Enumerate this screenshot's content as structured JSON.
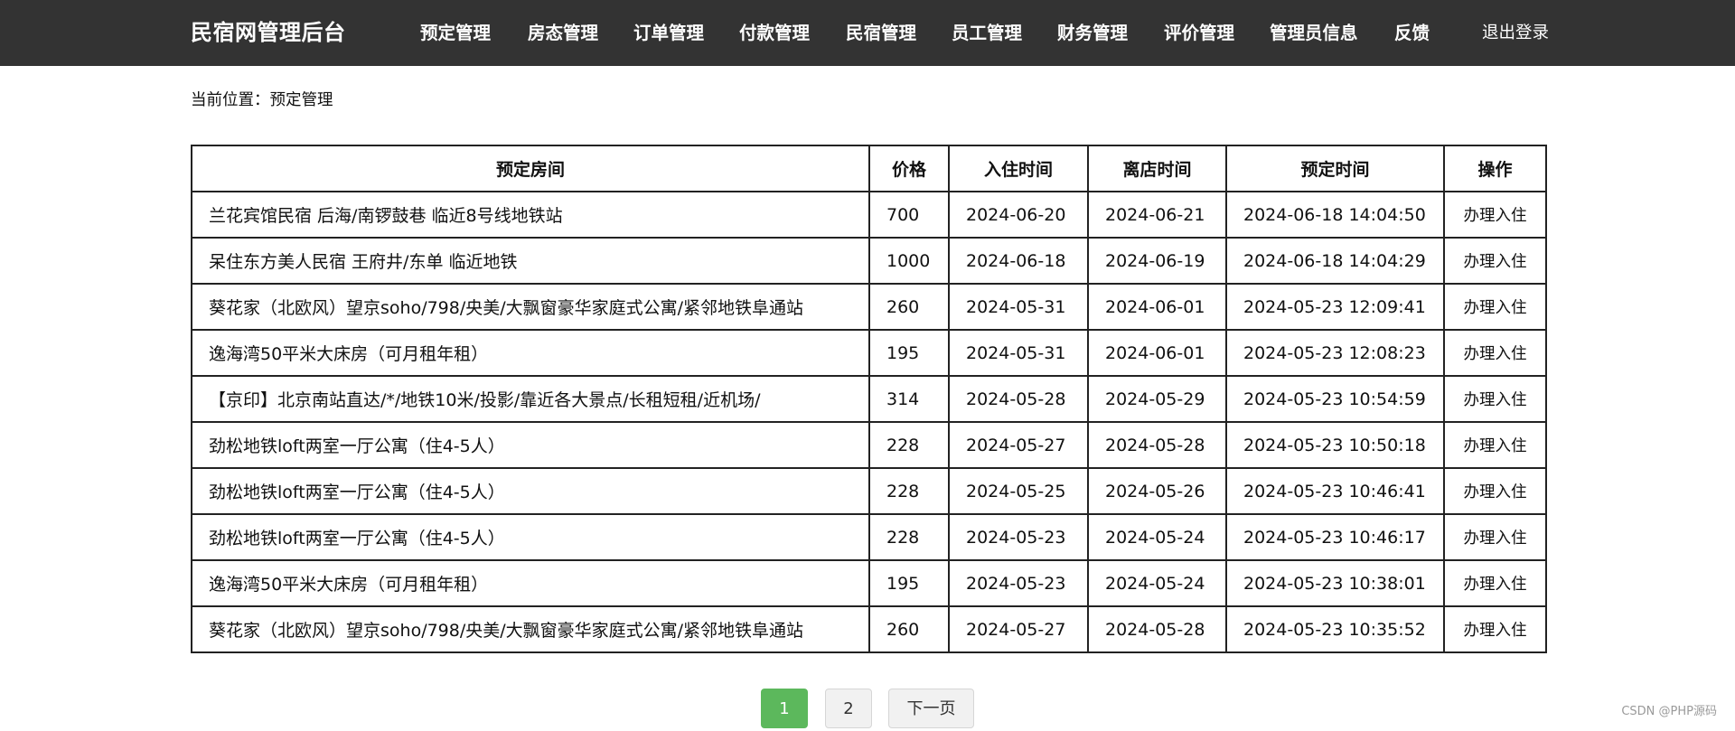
{
  "header": {
    "brand": "民宿网管理后台",
    "nav": [
      {
        "label": "预定管理"
      },
      {
        "label": "房态管理"
      },
      {
        "label": "订单管理"
      },
      {
        "label": "付款管理"
      },
      {
        "label": "民宿管理"
      },
      {
        "label": "员工管理"
      },
      {
        "label": "财务管理"
      },
      {
        "label": "评价管理"
      },
      {
        "label": "管理员信息"
      },
      {
        "label": "反馈"
      }
    ],
    "logout": "退出登录"
  },
  "breadcrumb": "当前位置：预定管理",
  "table": {
    "columns": [
      "预定房间",
      "价格",
      "入住时间",
      "离店时间",
      "预定时间",
      "操作"
    ],
    "rows": [
      [
        "兰花宾馆民宿 后海/南锣鼓巷 临近8号线地铁站",
        "700",
        "2024-06-20",
        "2024-06-21",
        "2024-06-18 14:04:50",
        "办理入住"
      ],
      [
        "呆住东方美人民宿 王府井/东单 临近地铁",
        "1000",
        "2024-06-18",
        "2024-06-19",
        "2024-06-18 14:04:29",
        "办理入住"
      ],
      [
        "葵花家（北欧风）望京soho/798/央美/大飘窗豪华家庭式公寓/紧邻地铁阜通站",
        "260",
        "2024-05-31",
        "2024-06-01",
        "2024-05-23 12:09:41",
        "办理入住"
      ],
      [
        "逸海湾50平米大床房（可月租年租）",
        "195",
        "2024-05-31",
        "2024-06-01",
        "2024-05-23 12:08:23",
        "办理入住"
      ],
      [
        "【京印】北京南站直达/*/地铁10米/投影/靠近各大景点/长租短租/近机场/",
        "314",
        "2024-05-28",
        "2024-05-29",
        "2024-05-23 10:54:59",
        "办理入住"
      ],
      [
        "劲松地铁loft两室一厅公寓（住4-5人）",
        "228",
        "2024-05-27",
        "2024-05-28",
        "2024-05-23 10:50:18",
        "办理入住"
      ],
      [
        "劲松地铁loft两室一厅公寓（住4-5人）",
        "228",
        "2024-05-25",
        "2024-05-26",
        "2024-05-23 10:46:41",
        "办理入住"
      ],
      [
        "劲松地铁loft两室一厅公寓（住4-5人）",
        "228",
        "2024-05-23",
        "2024-05-24",
        "2024-05-23 10:46:17",
        "办理入住"
      ],
      [
        "逸海湾50平米大床房（可月租年租）",
        "195",
        "2024-05-23",
        "2024-05-24",
        "2024-05-23 10:38:01",
        "办理入住"
      ],
      [
        "葵花家（北欧风）望京soho/798/央美/大飘窗豪华家庭式公寓/紧邻地铁阜通站",
        "260",
        "2024-05-27",
        "2024-05-28",
        "2024-05-23 10:35:52",
        "办理入住"
      ]
    ]
  },
  "pagination": {
    "pages": [
      "1",
      "2"
    ],
    "current": "1",
    "next_label": "下一页"
  },
  "watermark": "CSDN @PHP源码",
  "colors": {
    "topbar": "#333333",
    "active_page": "#5cb85c"
  }
}
